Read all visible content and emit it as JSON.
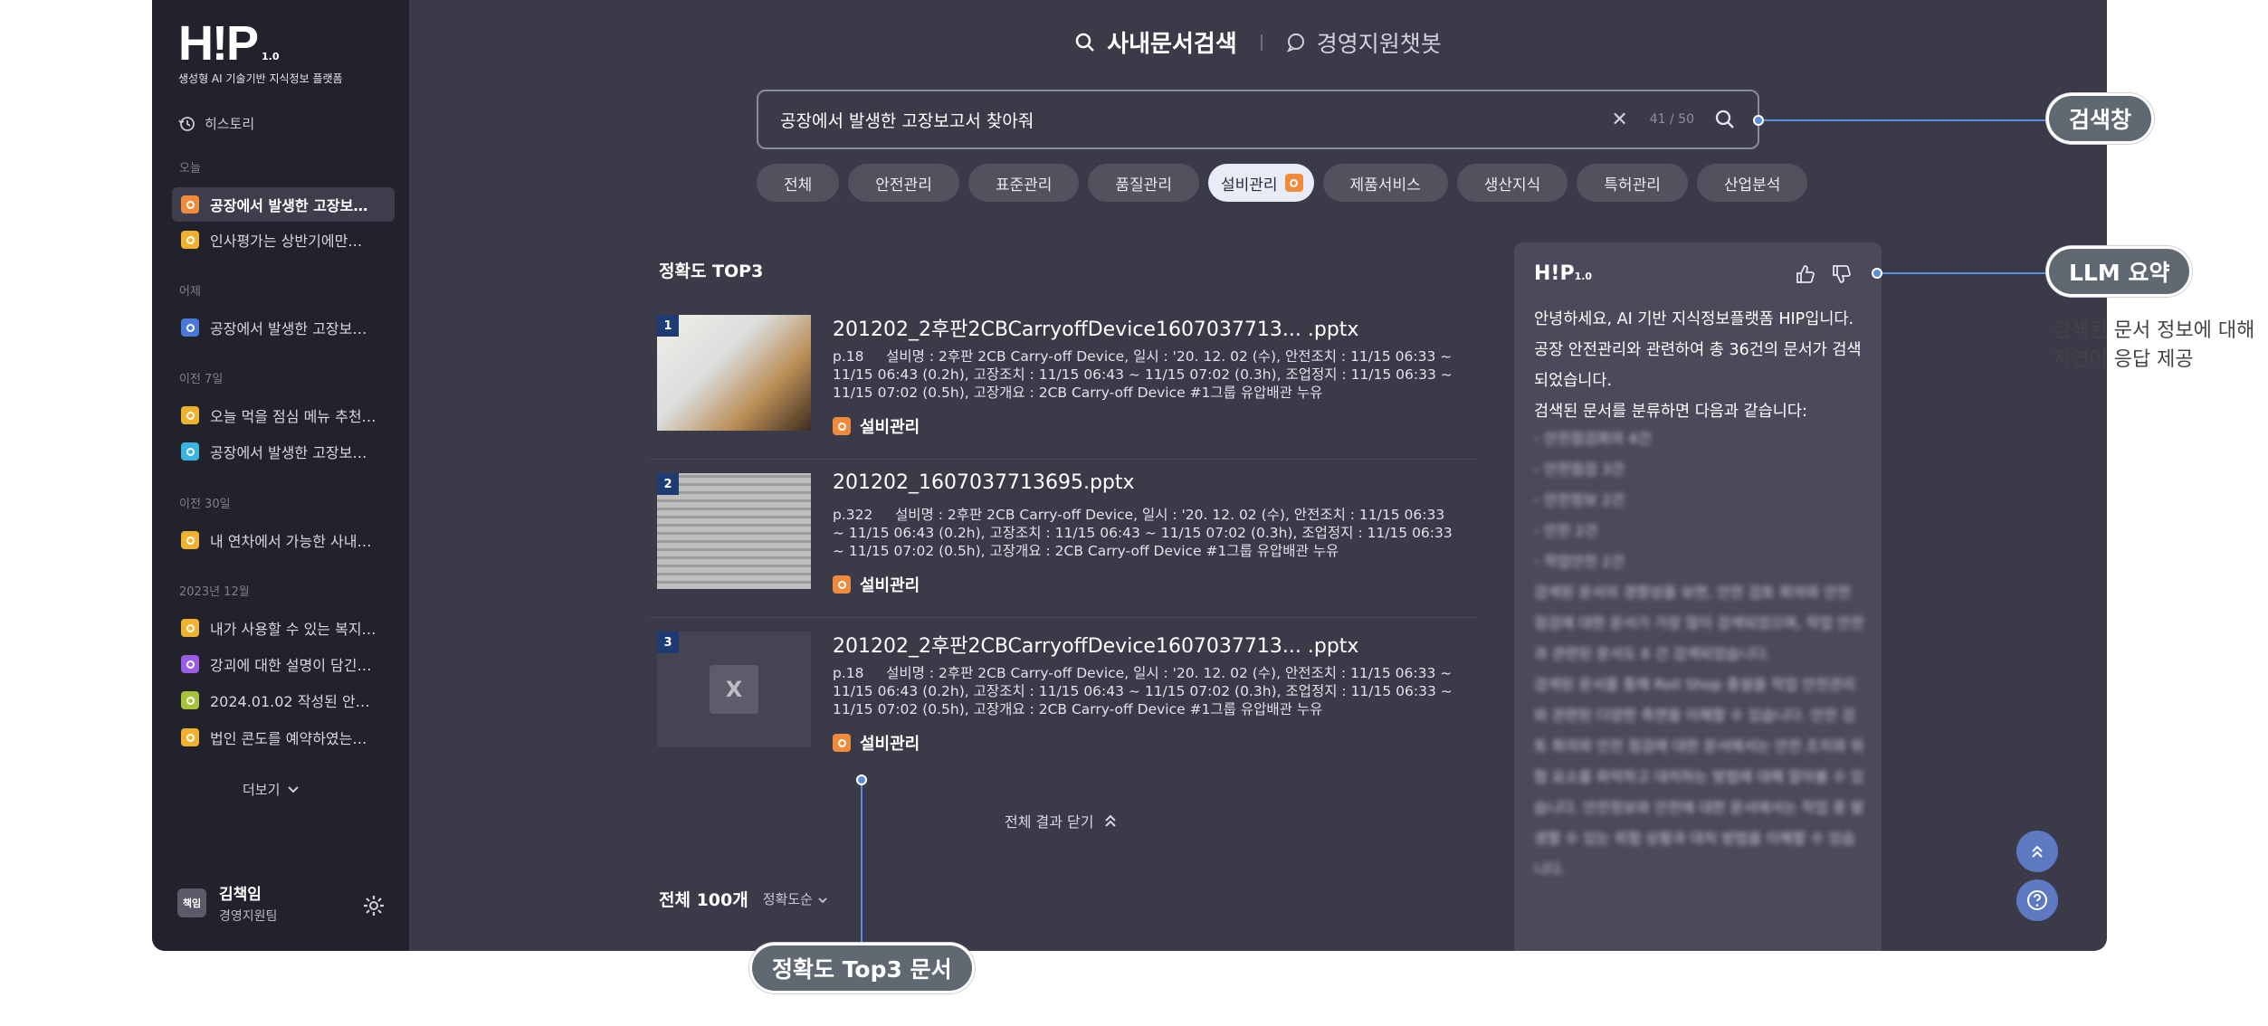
{
  "brand": {
    "logo": "H!P",
    "version": "1.0",
    "tagline": "생성형 AI 기술기반 지식정보 플랫폼"
  },
  "sidebar": {
    "history_label": "히스토리",
    "sections": [
      {
        "label": "오늘",
        "items": [
          {
            "text": "공장에서 발생한 고장보…",
            "color": "#f08a3c",
            "active": true
          },
          {
            "text": "인사평가는 상반기에만…",
            "color": "#f0b030"
          }
        ]
      },
      {
        "label": "어제",
        "items": [
          {
            "text": "공장에서 발생한 고장보…",
            "color": "#4a78d8"
          }
        ]
      },
      {
        "label": "이전 7일",
        "items": [
          {
            "text": "오늘 먹을 점심 메뉴 추천…",
            "color": "#f0b030"
          },
          {
            "text": "공장에서 발생한 고장보…",
            "color": "#38b4e0"
          }
        ]
      },
      {
        "label": "이전 30일",
        "items": [
          {
            "text": "내 연차에서 가능한 사내…",
            "color": "#f0b030"
          }
        ]
      },
      {
        "label": "2023년 12월",
        "items": [
          {
            "text": "내가 사용할 수 있는 복지…",
            "color": "#f0b030"
          },
          {
            "text": "강괴에 대한 설명이 담긴…",
            "color": "#9b5de5"
          },
          {
            "text": "2024.01.02 작성된 안…",
            "color": "#a8c23a"
          },
          {
            "text": "법인 콘도를 예약하였는…",
            "color": "#f0b030"
          }
        ]
      }
    ],
    "more_label": "더보기",
    "user": {
      "avatar": "책임",
      "name": "김책임",
      "dept": "경영지원팀"
    }
  },
  "header": {
    "mode_active": "사내문서검색",
    "mode_other": "경영지원챗봇"
  },
  "search": {
    "query": "공장에서 발생한 고장보고서 찾아줘",
    "counter": "41 / 50"
  },
  "filters": [
    "전체",
    "안전관리",
    "표준관리",
    "품질관리",
    "설비관리",
    "제품서비스",
    "생산지식",
    "특허관리",
    "산업분석"
  ],
  "results_heading": "정확도 TOP3",
  "results": [
    {
      "rank": "1",
      "title": "201202_2후판2CBCarryoffDevice1607037713... .pptx",
      "page": "p.18",
      "desc": "설비명 : 2후판 2CB Carry-off Device, 일시 : '20. 12. 02 (수), 안전조치 : 11/15 06:33 ~ 11/15 06:43 (0.2h), 고장조치 : 11/15 06:43 ~ 11/15 07:02 (0.3h), 조업정지 : 11/15 06:33 ~ 11/15 07:02 (0.5h), 고장개요 : 2CB Carry-off Device #1그룹 유압배관 누유",
      "category": "설비관리"
    },
    {
      "rank": "2",
      "title": "201202_1607037713695.pptx",
      "page": "p.322",
      "desc": "설비명 : 2후판 2CB Carry-off Device, 일시 : '20. 12. 02 (수), 안전조치 : 11/15 06:33 ~ 11/15 06:43 (0.2h), 고장조치 : 11/15 06:43 ~ 11/15 07:02 (0.3h), 조업정지 : 11/15 06:33 ~ 11/15 07:02 (0.5h), 고장개요 : 2CB Carry-off Device #1그룹 유압배관 누유",
      "category": "설비관리"
    },
    {
      "rank": "3",
      "title": "201202_2후판2CBCarryoffDevice1607037713... .pptx",
      "page": "p.18",
      "desc": "설비명 : 2후판 2CB Carry-off Device, 일시 : '20. 12. 02 (수), 안전조치 : 11/15 06:33 ~ 11/15 06:43 (0.2h), 고장조치 : 11/15 06:43 ~ 11/15 07:02 (0.3h), 조업정지 : 11/15 06:33 ~ 11/15 07:02 (0.5h), 고장개요 : 2CB Carry-off Device #1그룹 유압배관 누유",
      "category": "설비관리"
    }
  ],
  "close_all": "전체 결과 닫기",
  "total": {
    "count": "전체 100개",
    "sort": "정확도순"
  },
  "llm": {
    "logo": "H!P",
    "version": "1.0",
    "intro": "안녕하세요, AI 기반 지식정보플랫폼 HIP입니다. 공장 안전관리와 관련하여 총 36건의 문서가 검색되었습니다.",
    "classify": "검색된 문서를 분류하면 다음과 같습니다:",
    "blurred": "- 안전점검회의 4건\n- 안전점검 3건\n- 안전정보 2건\n- 안전 2건\n- 작업안전 2건\n검색된 문서의 경향성을 보면, 안전 검토 회의와 안전 점검에 대한 문서가 가장 많이 검색되었으며, 작업 안전과 관련된 문서도 6 건 검색되었습니다.\n검색된 문서를 통해 Roll Shop 증설을 작업 안전관리와 관련된 다양한 측면을 이해할 수 있습니다. 안전 검토 회의와 안전 점검에 대한 문서에서는 안전 조치와 위험 요소를 파악하고 대처하는 방법에 대해 알아볼 수 있습니다. 안전정보와 안전에 대한 문서에서는 작업 중 발생할 수 있는 위험 상황과 대처 방법을 이해할 수 있습니다."
  },
  "callouts": {
    "search": "검색창",
    "llm": "LLM 요약",
    "llm_desc_1": "검색된 문서 정보에 대해",
    "llm_desc_2": "자연어 응답 제공",
    "top3": "정확도 Top3 문서"
  }
}
